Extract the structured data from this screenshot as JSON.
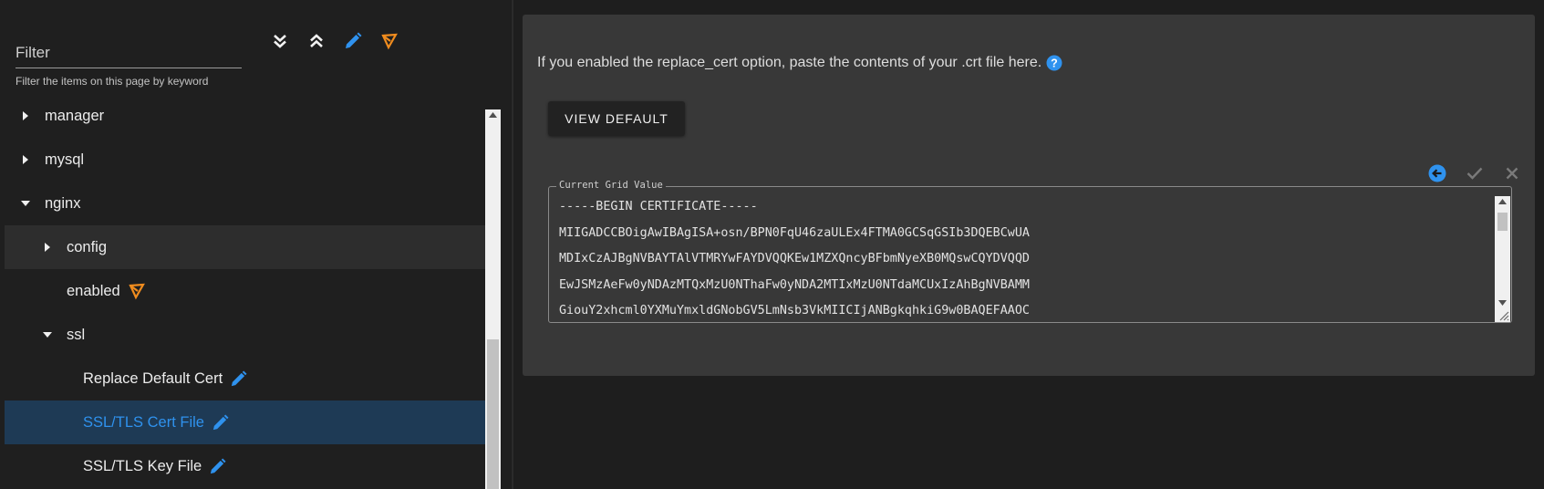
{
  "filter": {
    "placeholder": "Filter",
    "hint": "Filter the items on this page by keyword"
  },
  "toolbar": {
    "expand_all_icon": "double-chevron-down-icon",
    "collapse_all_icon": "double-chevron-up-icon",
    "edit_icon": "pencil-icon",
    "api_icon": "api-node-icon"
  },
  "tree": {
    "items": [
      {
        "label": "manager"
      },
      {
        "label": "mysql"
      },
      {
        "label": "nginx"
      },
      {
        "label": "config"
      },
      {
        "label": "enabled"
      },
      {
        "label": "ssl"
      },
      {
        "label": "Replace Default Cert"
      },
      {
        "label": "SSL/TLS Cert File"
      },
      {
        "label": "SSL/TLS Key File"
      }
    ]
  },
  "detail": {
    "description": "If you enabled the replace_cert option, paste the contents of your .crt file here.",
    "view_default_label": "VIEW DEFAULT",
    "field_legend": "Current Grid Value",
    "cert_lines": [
      "-----BEGIN CERTIFICATE-----",
      "MIIGADCCBOigAwIBAgISA+osn/BPN0FqU46zaULEx4FTMA0GCSqGSIb3DQEBCwUA",
      "MDIxCzAJBgNVBAYTAlVTMRYwFAYDVQQKEw1MZXQncyBFbmNyeXB0MQswCQYDVQQD",
      "EwJSMzAeFw0yNDAzMTQxMzU0NThaFw0yNDA2MTIxMzU0NTdaMCUxIzAhBgNVBAMM",
      "GiouY2xhcml0YXMuYmxldGNobGV5LmNsb3VkMIICIjANBgkqhkiG9w0BAQEFAAOC"
    ]
  },
  "colors": {
    "accent_blue": "#2f92ee",
    "accent_orange": "#f08c1e",
    "selected_row_bg": "#1e3a55",
    "panel_bg": "#383838"
  }
}
